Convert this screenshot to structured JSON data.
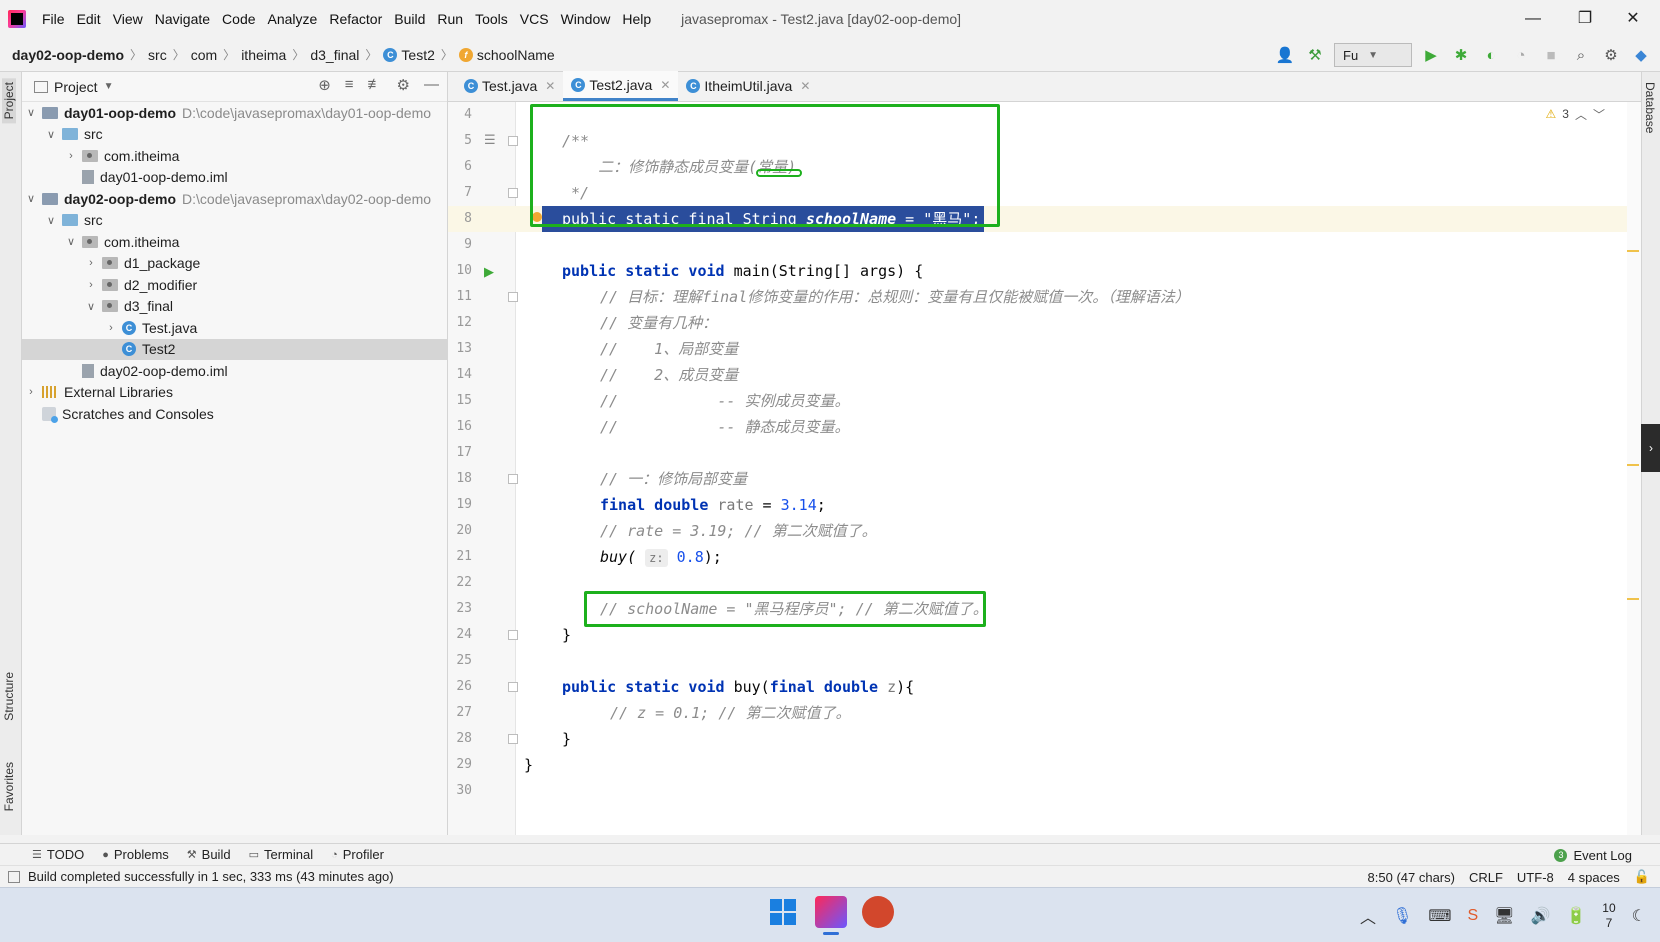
{
  "menu": {
    "items": [
      "File",
      "Edit",
      "View",
      "Navigate",
      "Code",
      "Analyze",
      "Refactor",
      "Build",
      "Run",
      "Tools",
      "VCS",
      "Window",
      "Help"
    ],
    "window_title": "javasepromax - Test2.java [day02-oop-demo]"
  },
  "window_controls": {
    "minimize": "—",
    "restore": "❐",
    "close": "✕"
  },
  "breadcrumb": {
    "project": "day02-oop-demo",
    "parts": [
      "src",
      "com",
      "itheima",
      "d3_final"
    ],
    "class": "Test2",
    "member": "schoolName"
  },
  "toolbar": {
    "run_config": "Fu"
  },
  "left_stripe": {
    "project": "Project",
    "structure": "Structure",
    "favorites": "Favorites"
  },
  "right_stripe": {
    "database": "Database"
  },
  "project_panel": {
    "title": "Project",
    "tree": [
      {
        "name": "day01-oop-demo",
        "path": "D:\\code\\javasepromax\\day01-oop-demo"
      },
      {
        "name": "src"
      },
      {
        "name": "com.itheima"
      },
      {
        "name": "day01-oop-demo.iml"
      },
      {
        "name": "day02-oop-demo",
        "path": "D:\\code\\javasepromax\\day02-oop-demo"
      },
      {
        "name": "src"
      },
      {
        "name": "com.itheima"
      },
      {
        "name": "d1_package"
      },
      {
        "name": "d2_modifier"
      },
      {
        "name": "d3_final"
      },
      {
        "name": "Test.java"
      },
      {
        "name": "Test2"
      },
      {
        "name": "day02-oop-demo.iml"
      },
      {
        "name": "External Libraries"
      },
      {
        "name": "Scratches and Consoles"
      }
    ]
  },
  "editor": {
    "tabs": [
      "Test.java",
      "Test2.java",
      "ItheimUtil.java"
    ],
    "active_tab": "Test2.java",
    "warnings": "3",
    "line_numbers": [
      "4",
      "5",
      "6",
      "7",
      "8",
      "9",
      "10",
      "11",
      "12",
      "13",
      "14",
      "15",
      "16",
      "17",
      "18",
      "19",
      "20",
      "21",
      "22",
      "23",
      "24",
      "25",
      "26",
      "27",
      "28",
      "29",
      "30"
    ],
    "code": {
      "l5": "/**",
      "l6": "    二：修饰静态成员变量(常量)",
      "l7": " */",
      "l8": {
        "kw": "public static final",
        "type": " String ",
        "field": "schoolName",
        "op": " = ",
        "str": "\"黑马\"",
        "end": ";"
      },
      "l10": {
        "kw": "public static void",
        "rest": " main(String[] args) {"
      },
      "l11": "// 目标：理解final修饰变量的作用：总规则：变量有且仅能被赋值一次。（理解语法）",
      "l12": "// 变量有几种：",
      "l13": "//    1、局部变量",
      "l14": "//    2、成员变量",
      "l15": "//           -- 实例成员变量。",
      "l16": "//           -- 静态成员变量。",
      "l18": "// 一：修饰局部变量",
      "l19": {
        "kw": "final double",
        "var": " rate",
        "op": " = ",
        "num": "3.14",
        "end": ";"
      },
      "l20": "// rate = 3.19; // 第二次赋值了。",
      "l21": {
        "call": "buy(",
        "hint": "z:",
        "num": "0.8",
        "end": ");"
      },
      "l23": "// schoolName = \"黑马程序员\"; // 第二次赋值了。",
      "l24": "}",
      "l26": {
        "kw": "public static void",
        "mid": " buy(",
        "kw2": "final double",
        "param": " z",
        "end": "){"
      },
      "l27": "// z = 0.1; // 第二次赋值了。",
      "l28": "}",
      "l29": "}"
    }
  },
  "tool_windows": [
    "TODO",
    "Problems",
    "Build",
    "Terminal",
    "Profiler"
  ],
  "event_log": {
    "count": "3",
    "label": "Event Log"
  },
  "status": {
    "message": "Build completed successfully in 1 sec, 333 ms (43 minutes ago)",
    "position": "8:50 (47 chars)",
    "line_sep": "CRLF",
    "encoding": "UTF-8",
    "indent": "4 spaces"
  },
  "taskbar": {
    "clock_top": "10",
    "clock_bottom": "7"
  },
  "colors": {
    "highlight_box": "#1db01d",
    "selection": "#2a4d9c",
    "keyword": "#0033b3",
    "string": "#067d17",
    "accent": "#4083c9"
  }
}
